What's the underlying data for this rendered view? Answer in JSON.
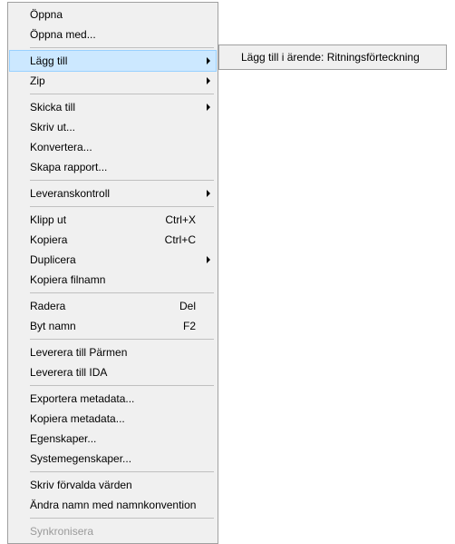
{
  "main_menu": {
    "oppna": "Öppna",
    "oppna_med": "Öppna med...",
    "lagg_till": "Lägg till",
    "zip": "Zip",
    "skicka_till": "Skicka till",
    "skriv_ut": "Skriv ut...",
    "konvertera": "Konvertera...",
    "skapa_rapport": "Skapa rapport...",
    "leveranskontroll": "Leveranskontroll",
    "klipp_ut": "Klipp ut",
    "klipp_ut_sc": "Ctrl+X",
    "kopiera": "Kopiera",
    "kopiera_sc": "Ctrl+C",
    "duplicera": "Duplicera",
    "kopiera_filnamn": "Kopiera filnamn",
    "radera": "Radera",
    "radera_sc": "Del",
    "byt_namn": "Byt namn",
    "byt_namn_sc": "F2",
    "leverera_parmen": "Leverera till Pärmen",
    "leverera_ida": "Leverera till IDA",
    "exportera_metadata": "Exportera metadata...",
    "kopiera_metadata": "Kopiera metadata...",
    "egenskaper": "Egenskaper...",
    "systemegenskaper": "Systemegenskaper...",
    "skriv_forvalda": "Skriv förvalda värden",
    "andra_namn": "Ändra namn med namnkonvention",
    "synkronisera": "Synkronisera"
  },
  "submenu": {
    "lagg_till_arende": "Lägg till i ärende: Ritningsförteckning"
  }
}
